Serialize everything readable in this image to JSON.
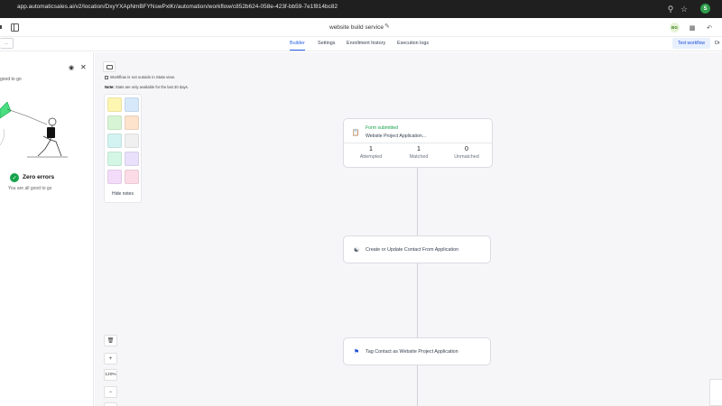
{
  "browser": {
    "url": "app.automaticsales.ai/v2/location/DxyYXApNmBFYNswPxlKr/automation/workflow/c852b624-058e-423f-bb59-7e1f814bc82",
    "profile_initial": "S"
  },
  "header": {
    "workflow_title": "website build service",
    "avatar_initials": "BG"
  },
  "tabs": [
    {
      "label": "Builder",
      "active": true
    },
    {
      "label": "Settings",
      "active": false
    },
    {
      "label": "Enrollment history",
      "active": false
    },
    {
      "label": "Execution logs",
      "active": false
    }
  ],
  "toolbar": {
    "back_label": "...",
    "test_workflow_label": "Test workflow",
    "right_cut_label": "Dr"
  },
  "left_panel": {
    "top_text": "good to go",
    "status_title": "Zero errors",
    "status_text": "You are all good to go"
  },
  "stats": {
    "checkbox_label": "Workflow is not outside in Stats view.",
    "note_bold": "Note:",
    "note_text": "Stats are only available for the last 30 days."
  },
  "palette": {
    "colors": [
      "#fdf6b0",
      "#d6e9fb",
      "#d7f5d4",
      "#fde2cc",
      "#d2f3f2",
      "#f0f0f0",
      "#d3f7e4",
      "#e9e1fb",
      "#f3dcf9",
      "#fbdce6"
    ],
    "hide_label": "Hide notes"
  },
  "zoom": {
    "level": "120%",
    "plus": "+",
    "minus": "−"
  },
  "nodes": {
    "trigger": {
      "type": "Form submitted",
      "name": "Website Project Application...",
      "stats": [
        {
          "value": "1",
          "label": "Attempted"
        },
        {
          "value": "1",
          "label": "Matched"
        },
        {
          "value": "0",
          "label": "Unmatched"
        }
      ]
    },
    "action1": {
      "label": "Create or Update Contact From Application"
    },
    "action2": {
      "label": "Tag Contact as Website Project Application"
    }
  },
  "colors": {
    "accent": "#2563eb",
    "success": "#16a34a"
  }
}
